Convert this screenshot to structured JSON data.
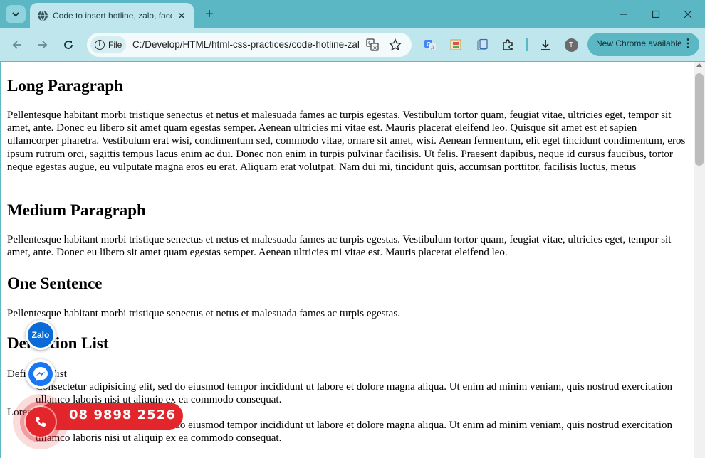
{
  "browser": {
    "tab_title": "Code to insert hotline, zalo, facebook",
    "tab_close": "✕",
    "new_tab": "+",
    "omnibox": {
      "chip_label": "File",
      "url": "C:/Develop/HTML/html-css-practices/code-hotline-zalo-facebook.html"
    },
    "profile_initial": "T",
    "update_label": "New Chrome available",
    "update_menu": "⋮",
    "accent": "#5ab7c3"
  },
  "page": {
    "sections": [
      {
        "heading": "Long Paragraph",
        "text": "Pellentesque habitant morbi tristique senectus et netus et malesuada fames ac turpis egestas. Vestibulum tortor quam, feugiat vitae, ultricies eget, tempor sit amet, ante. Donec eu libero sit amet quam egestas semper. Aenean ultricies mi vitae est. Mauris placerat eleifend leo. Quisque sit amet est et sapien ullamcorper pharetra. Vestibulum erat wisi, condimentum sed, commodo vitae, ornare sit amet, wisi. Aenean fermentum, elit eget tincidunt condimentum, eros ipsum rutrum orci, sagittis tempus lacus enim ac dui. Donec non enim in turpis pulvinar facilisis. Ut felis. Praesent dapibus, neque id cursus faucibus, tortor neque egestas augue, eu vulputate magna eros eu erat. Aliquam erat volutpat. Nam dui mi, tincidunt quis, accumsan porttitor, facilisis luctus, metus"
      },
      {
        "heading": "Medium Paragraph",
        "text": "Pellentesque habitant morbi tristique senectus et netus et malesuada fames ac turpis egestas. Vestibulum tortor quam, feugiat vitae, ultricies eget, tempor sit amet, ante. Donec eu libero sit amet quam egestas semper. Aenean ultricies mi vitae est. Mauris placerat eleifend leo."
      },
      {
        "heading": "One Sentence",
        "text": "Pellentesque habitant morbi tristique senectus et netus et malesuada fames ac turpis egestas."
      },
      {
        "heading": "Definition List",
        "items": [
          {
            "term": "Definition list",
            "desc": "Consectetur adipisicing elit, sed do eiusmod tempor incididunt ut labore et dolore magna aliqua. Ut enim ad minim veniam, quis nostrud exercitation ullamco laboris nisi ut aliquip ex ea commodo consequat."
          },
          {
            "term": "Lorem ipsum dolor sit amet",
            "desc": "Consectetur adipisicing elit, sed do eiusmod tempor incididunt ut labore et dolore magna aliqua. Ut enim ad minim veniam, quis nostrud exercitation ullamco laboris nisi ut aliquip ex ea commodo consequat."
          }
        ]
      }
    ]
  },
  "widgets": {
    "zalo_label": "Zalo",
    "hotline_number": "08 9898 2526",
    "hotline_color": "#e3262b",
    "zalo_color": "#0a6bd7",
    "messenger_color": "#1877f2"
  }
}
